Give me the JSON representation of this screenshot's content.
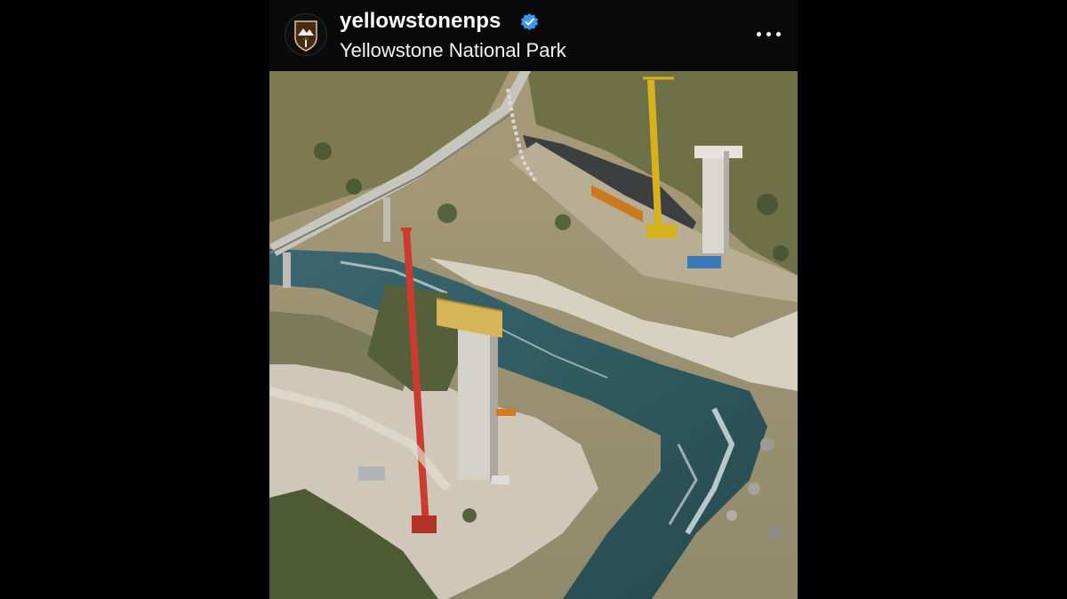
{
  "post": {
    "username": "yellowstonenps",
    "full_name": "Yellowstone National Park",
    "verified": true,
    "avatar_icon": "nps-arrowhead-logo-icon",
    "verified_icon": "verified-badge-icon",
    "more_icon": "more-options-icon"
  },
  "photo": {
    "subject": "aerial view of bridge construction over a river with cranes and concrete piers"
  },
  "colors": {
    "background": "#000000",
    "header_bg": "#0a0a0a",
    "verified_blue": "#3897f0",
    "text": "#ffffff"
  }
}
